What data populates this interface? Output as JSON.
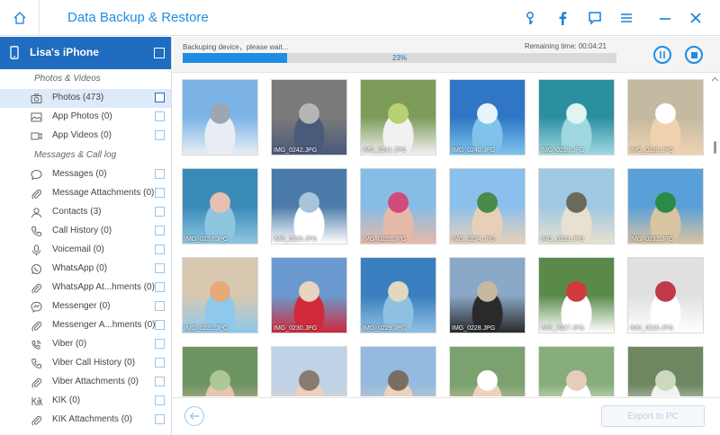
{
  "app": {
    "title": "Data Backup & Restore"
  },
  "titlebar_icons": [
    "home-icon",
    "key-icon",
    "facebook-icon",
    "feedback-icon",
    "menu-icon",
    "minimize-icon",
    "close-icon"
  ],
  "device": {
    "name": "Lisa's iPhone"
  },
  "sidebar": {
    "sections": [
      {
        "title": "Photos & Videos",
        "items": [
          {
            "label": "Photos (473)",
            "icon": "camera-icon",
            "selected": true
          },
          {
            "label": "App Photos (0)",
            "icon": "image-icon",
            "selected": false
          },
          {
            "label": "App Videos (0)",
            "icon": "video-icon",
            "selected": false
          }
        ]
      },
      {
        "title": "Messages & Call log",
        "items": [
          {
            "label": "Messages (0)",
            "icon": "message-icon",
            "selected": false
          },
          {
            "label": "Message Attachments (0)",
            "icon": "attachment-icon",
            "selected": false
          },
          {
            "label": "Contacts (3)",
            "icon": "contacts-icon",
            "selected": false
          },
          {
            "label": "Call History (0)",
            "icon": "phone-icon",
            "selected": false
          },
          {
            "label": "Voicemail (0)",
            "icon": "microphone-icon",
            "selected": false
          },
          {
            "label": "WhatsApp (0)",
            "icon": "whatsapp-icon",
            "selected": false
          },
          {
            "label": "WhatsApp At...hments (0)",
            "icon": "attachment-icon",
            "selected": false
          },
          {
            "label": "Messenger (0)",
            "icon": "messenger-icon",
            "selected": false
          },
          {
            "label": "Messenger A...hments (0)",
            "icon": "attachment-icon",
            "selected": false
          },
          {
            "label": "Viber (0)",
            "icon": "viber-icon",
            "selected": false
          },
          {
            "label": "Viber Call History (0)",
            "icon": "phone-icon",
            "selected": false
          },
          {
            "label": "Viber Attachments (0)",
            "icon": "attachment-icon",
            "selected": false
          },
          {
            "label": "KIK (0)",
            "icon": "kik-icon",
            "selected": false
          },
          {
            "label": "KIK Attachments (0)",
            "icon": "attachment-icon",
            "selected": false
          }
        ]
      }
    ]
  },
  "progress": {
    "status": "Backuping device，please wait...",
    "remaining": "Remaining time: 00:04:21",
    "percent_label": "23%",
    "fraction": 0.24
  },
  "photos": [
    {
      "caption": "",
      "colors": [
        "#7db4e6",
        "#e8eef4",
        "#9ca7b3"
      ]
    },
    {
      "caption": "IMG_0242.JPG",
      "colors": [
        "#7a7a7a",
        "#4a5a7a",
        "#b5b5b5"
      ]
    },
    {
      "caption": "IMG_0241.JPG",
      "colors": [
        "#7d9c5a",
        "#f1f1f1",
        "#b8d070"
      ]
    },
    {
      "caption": "IMG_0240.JPG",
      "colors": [
        "#2f77c6",
        "#7fc3ea",
        "#e7f4fb"
      ]
    },
    {
      "caption": "IMG_0239.JPG",
      "colors": [
        "#2c8fa0",
        "#a0d8e0",
        "#e0f4f2"
      ]
    },
    {
      "caption": "IMG_0238.JPG",
      "colors": [
        "#c4b9a1",
        "#f0d2b0",
        "#ffffff"
      ]
    },
    {
      "caption": "IMG_0237.JPG",
      "colors": [
        "#3a8ab8",
        "#8ec6e0",
        "#e8c0b0"
      ]
    },
    {
      "caption": "IMG_0236.JPG",
      "colors": [
        "#4b7ba8",
        "#ffffff",
        "#a7c4dc"
      ]
    },
    {
      "caption": "IMG_0235.JPG",
      "colors": [
        "#86bde6",
        "#e7b9a8",
        "#d04a7a"
      ]
    },
    {
      "caption": "IMG_0234.JPG",
      "colors": [
        "#8cc0ec",
        "#e8d0b8",
        "#4a8a4a"
      ]
    },
    {
      "caption": "IMG_0233.JPG",
      "colors": [
        "#9fc8e2",
        "#e8e0d0",
        "#6a6a5a"
      ]
    },
    {
      "caption": "IMG_0232.JPG",
      "colors": [
        "#5aa0d8",
        "#d8c4a0",
        "#2a8a4a"
      ]
    },
    {
      "caption": "IMG_0231.JPG",
      "colors": [
        "#d8c8b0",
        "#8ec8ea",
        "#e7a87a"
      ]
    },
    {
      "caption": "IMG_0230.JPG",
      "colors": [
        "#6a9ad0",
        "#d02a3a",
        "#e8d4c0"
      ]
    },
    {
      "caption": "IMG_0229.JPG",
      "colors": [
        "#3a7fc0",
        "#90c0e0",
        "#e0d8c0"
      ]
    },
    {
      "caption": "IMG_0228.JPG",
      "colors": [
        "#8aa8c8",
        "#2a2a2a",
        "#c8b8a0"
      ]
    },
    {
      "caption": "IMG_0227.JPG",
      "colors": [
        "#5a8a4a",
        "#ffffff",
        "#d03a3a"
      ]
    },
    {
      "caption": "IMG_0226.JPG",
      "colors": [
        "#e0e0e0",
        "#ffffff",
        "#c03a4a"
      ]
    },
    {
      "caption": "",
      "colors": [
        "#4a7a3a",
        "#e0b8a0",
        "#9ab87a"
      ]
    },
    {
      "caption": "",
      "colors": [
        "#b0c8e0",
        "#e8c4b0",
        "#6a5a4a"
      ]
    },
    {
      "caption": "",
      "colors": [
        "#7aaad8",
        "#e8c8b0",
        "#5a4a3a"
      ]
    },
    {
      "caption": "",
      "colors": [
        "#5a8a4a",
        "#e8c8b0",
        "#ffffff"
      ]
    },
    {
      "caption": "",
      "colors": [
        "#6a9a5a",
        "#ffffff",
        "#e0c0a8"
      ]
    },
    {
      "caption": "",
      "colors": [
        "#4a6a3a",
        "#f0f0f0",
        "#c0d0b0"
      ]
    }
  ],
  "buttons": {
    "pause": "pause-icon",
    "stop": "stop-icon",
    "back": "back-arrow-icon",
    "export_label": "Export to PC"
  }
}
